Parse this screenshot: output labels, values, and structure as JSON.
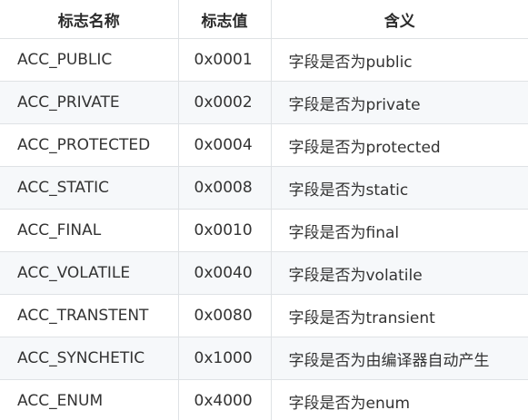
{
  "table": {
    "headers": [
      "标志名称",
      "标志值",
      "含义"
    ],
    "rows": [
      [
        "ACC_PUBLIC",
        "0x0001",
        "字段是否为public"
      ],
      [
        "ACC_PRIVATE",
        "0x0002",
        "字段是否为private"
      ],
      [
        "ACC_PROTECTED",
        "0x0004",
        "字段是否为protected"
      ],
      [
        "ACC_STATIC",
        "0x0008",
        "字段是否为static"
      ],
      [
        "ACC_FINAL",
        "0x0010",
        "字段是否为final"
      ],
      [
        "ACC_VOLATILE",
        "0x0040",
        "字段是否为volatile"
      ],
      [
        "ACC_TRANSTENT",
        "0x0080",
        "字段是否为transient"
      ],
      [
        "ACC_SYNCHETIC",
        "0x1000",
        "字段是否为由编译器自动产生"
      ],
      [
        "ACC_ENUM",
        "0x4000",
        "字段是否为enum"
      ]
    ]
  },
  "colors": {
    "border": "#dfe2e5",
    "stripe": "#f6f8fa",
    "text": "#333333"
  }
}
